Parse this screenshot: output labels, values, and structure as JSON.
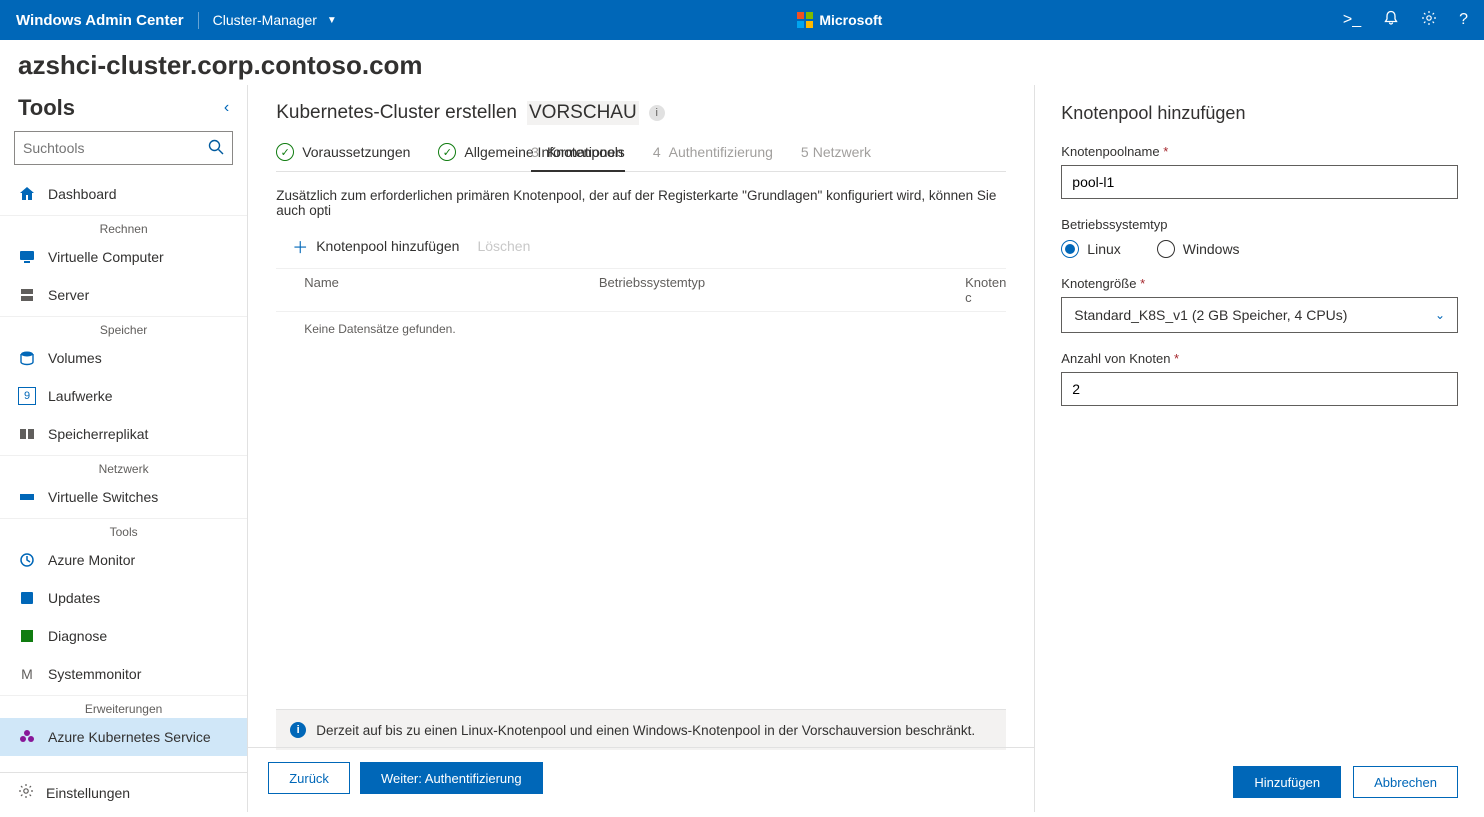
{
  "topbar": {
    "brand": "Windows Admin Center",
    "context": "Cluster-Manager",
    "center": "Microsoft"
  },
  "cluster_name": "azshci-cluster.corp.contoso.com",
  "sidebar": {
    "tools_label": "Tools",
    "search_placeholder": "Suchtools",
    "groups": {
      "compute": "Rechnen",
      "storage": "Speicher",
      "network": "Netzwerk",
      "tools": "Tools",
      "extensions": "Erweiterungen"
    },
    "items": {
      "dashboard": "Dashboard",
      "vms": "Virtuelle Computer",
      "server": "Server",
      "volumes": "Volumes",
      "drives": "Laufwerke",
      "replica": "Speicherreplikat",
      "vswitches": "Virtuelle Switches",
      "azmon": "Azure Monitor",
      "updates": "Updates",
      "diagnose": "Diagnose",
      "sysmon": "Systemmonitor",
      "aks": "Azure Kubernetes Service",
      "settings": "Einstellungen"
    }
  },
  "main": {
    "title_a": "Kubernetes-Cluster erstellen ",
    "title_b": "VORSCHAU",
    "steps": {
      "s1": "Voraussetzungen",
      "s2": "Allgemeine Informationen",
      "s3_num": "3",
      "s3": "Knotenpools",
      "s4_num": "4",
      "s4": "Authentifizierung",
      "s5_num": "5",
      "s5": "Netzwerk"
    },
    "desc": "Zusätzlich zum erforderlichen primären Knotenpool, der auf der Registerkarte \"Grundlagen\" konfiguriert wird, können Sie auch opti",
    "toolbar": {
      "add": "Knotenpool hinzufügen",
      "delete": "Löschen"
    },
    "table": {
      "col1": "Name",
      "col2": "Betriebssystemtyp",
      "col3": "Knoten c",
      "empty": "Keine Datensätze gefunden."
    },
    "banner": "Derzeit auf bis zu einen Linux-Knotenpool und einen Windows-Knotenpool in der Vorschauversion beschränkt.",
    "back": "Zurück",
    "next": "Weiter: Authentifizierung"
  },
  "panel": {
    "title": "Knotenpool hinzufügen",
    "name_label": "Knotenpoolname",
    "name_value": "pool-l1",
    "os_label": "Betriebssystemtyp",
    "os_linux": "Linux",
    "os_windows": "Windows",
    "size_label": "Knotengröße",
    "size_value": "Standard_K8S_v1 (2 GB Speicher, 4 CPUs)",
    "count_label": "Anzahl von Knoten",
    "count_value": "2",
    "add": "Hinzufügen",
    "cancel": "Abbrechen"
  }
}
